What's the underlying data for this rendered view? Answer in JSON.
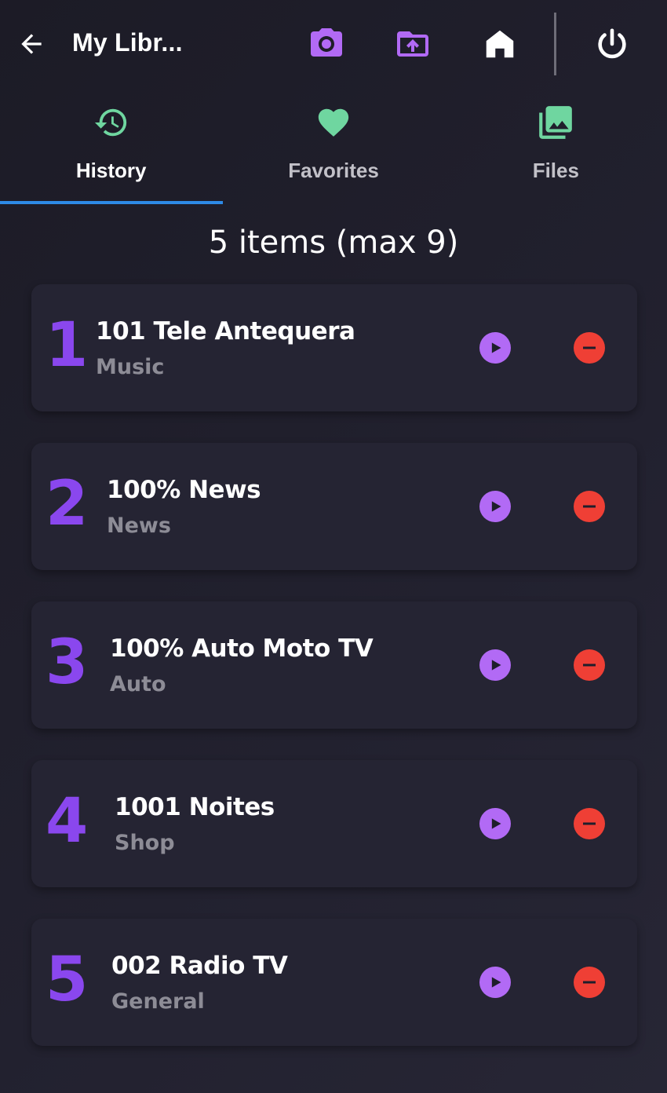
{
  "header": {
    "title": "My Libr...",
    "icons": [
      "back-arrow-icon",
      "camera-icon",
      "folder-upload-icon",
      "home-icon",
      "power-icon"
    ]
  },
  "tabs": [
    {
      "label": "History",
      "icon": "history-icon",
      "active": true
    },
    {
      "label": "Favorites",
      "icon": "heart-icon",
      "active": false
    },
    {
      "label": "Files",
      "icon": "photo-library-icon",
      "active": false
    }
  ],
  "count_text": "5 items (max 9)",
  "items": [
    {
      "rank": "1",
      "name": "101 Tele Antequera",
      "category": "Music"
    },
    {
      "rank": "2",
      "name": "100% News",
      "category": "News"
    },
    {
      "rank": "3",
      "name": "100% Auto Moto TV",
      "category": "Auto"
    },
    {
      "rank": "4",
      "name": "1001 Noites",
      "category": "Shop"
    },
    {
      "rank": "5",
      "name": "002 Radio TV",
      "category": "General"
    }
  ],
  "colors": {
    "accent_purple": "#b26af5",
    "rank_purple": "#8a47ee",
    "tab_icon_green": "#6fd6a0",
    "remove_red": "#ef3f35",
    "tab_indicator_blue": "#2e8ae6",
    "background": "#1f1e2b",
    "card": "#252433"
  }
}
